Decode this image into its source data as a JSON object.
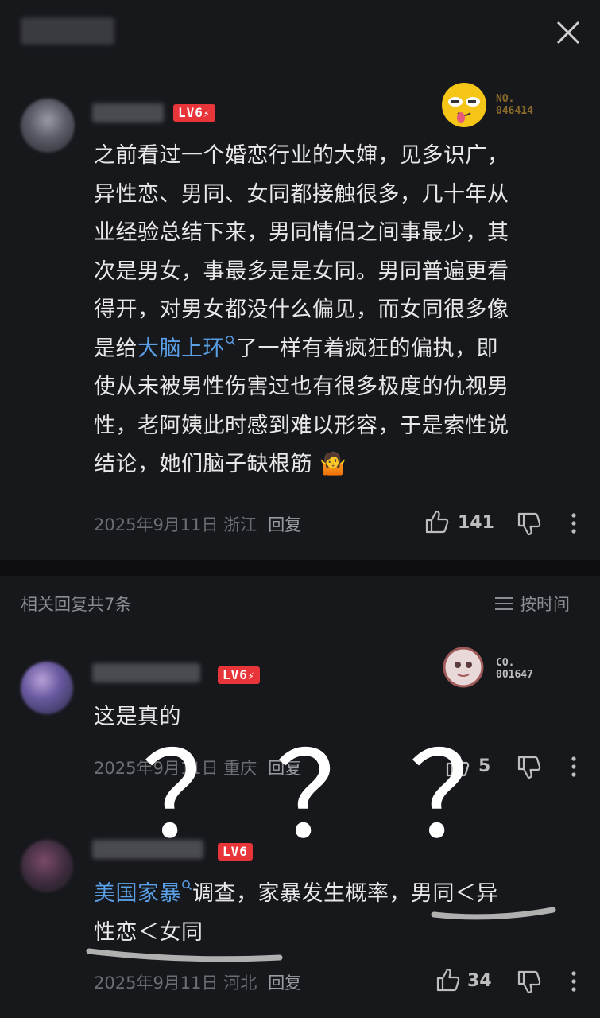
{
  "close_icon": "close-icon",
  "main_comment": {
    "level": "LV6",
    "level_badge_bolt": "⚡",
    "badge_number_top": "NO.",
    "badge_number_bottom": "046414",
    "text_lines": [
      "之前看过一个婚恋行业的大婶，见多识广，",
      "异性恋、男同、女同都接触很多，几十年从",
      "业经验总结下来，男同情侣之间事最少，其",
      "次是男女，事最多是是女同。男同普遍更看",
      "得开，对男女都没什么偏见，而女同很多像"
    ],
    "line6_pre": "是给",
    "line6_link": "大脑上环",
    "line6_post": "了一样有着疯狂的偏执，即",
    "text_lines_tail": [
      "使从未被男性伤害过也有很多极度的仇视男",
      "性，老阿姨此时感到难以形容，于是索性说",
      "结论，她们脑子缺根筋"
    ],
    "emoji": "🤷",
    "date": "2025年9月11日 浙江",
    "reply": "回复",
    "likes": "141"
  },
  "replies_header": {
    "title": "相关回复共7条",
    "sort": "按时间"
  },
  "reply1": {
    "level": "LV6",
    "badge_top": "CO.",
    "badge_bottom": "001647",
    "text": "这是真的",
    "date": "2025年9月11日 重庆",
    "reply": "回复",
    "likes": "5"
  },
  "overlay_marks": [
    "？",
    "？",
    "？"
  ],
  "reply2": {
    "level": "LV6",
    "link": "美国家暴",
    "text_after_link": "调查，家暴发生概率，男同＜异",
    "line2": "性恋＜女同",
    "date": "2025年9月11日 河北",
    "reply": "回复",
    "likes": "34"
  },
  "colors": {
    "accent_link": "#5aa0e6",
    "level_badge": "#e8353a",
    "background": "#17181c"
  }
}
